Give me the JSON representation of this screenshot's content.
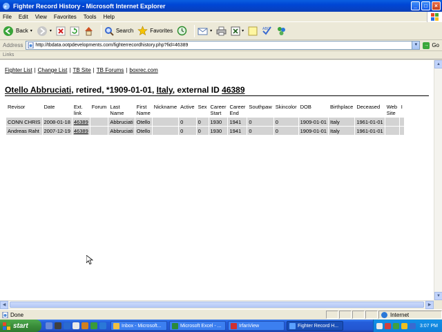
{
  "window": {
    "title": "Fighter Record History - Microsoft Internet Explorer",
    "controls": [
      "_",
      "□",
      "×"
    ]
  },
  "menu": [
    "File",
    "Edit",
    "View",
    "Favorites",
    "Tools",
    "Help"
  ],
  "toolbar": {
    "back": "Back",
    "search": "Search",
    "favorites": "Favorites"
  },
  "address": {
    "label": "Address",
    "url": "http://tbdata.ootpdevelopments.com/fighterrecordhistory.php?fid=46389",
    "go": "Go"
  },
  "links_label": "Links",
  "page": {
    "nav": [
      "Fighter List",
      "Change List",
      "TB Site",
      "TB Forums",
      "boxrec.com"
    ],
    "heading": {
      "name": "Otello Abbruciati",
      "mid": ", retired, *1909-01-01, ",
      "country": "Italy",
      "ext_prefix": ", external ID ",
      "ext_id": "46389"
    },
    "table": {
      "headers": [
        "Revisor",
        "Date",
        "Ext. link",
        "Forum",
        "Last Name",
        "First Name",
        "Nickname",
        "Active",
        "Sex",
        "Career Start",
        "Career End",
        "Southpaw",
        "Skincolor",
        "DOB",
        "Birthplace",
        "Deceased",
        "Web Site",
        "I"
      ],
      "rows": [
        [
          "CONN CHRIS",
          "2008-01-18",
          "46389",
          "",
          "Abbruciati",
          "Otello",
          "",
          "0",
          "0",
          "1930",
          "1941",
          "0",
          "0",
          "1909-01-01",
          "Italy",
          "1961-01-01",
          "",
          ""
        ],
        [
          "Andreas Raht",
          "2007-12-19",
          "46389",
          "",
          "Abbruciati",
          "Otello",
          "",
          "0",
          "0",
          "1930",
          "1941",
          "0",
          "0",
          "1909-01-01",
          "Italy",
          "1961-01-01",
          "",
          ""
        ]
      ]
    }
  },
  "status": {
    "text": "Done",
    "zone": "Internet"
  },
  "taskbar": {
    "start": "start",
    "tasks": [
      "Inbox - Microsoft...",
      "Microsoft Excel - ...",
      "IrfanView",
      "Fighter Record H..."
    ],
    "clock": "3:07 PM"
  },
  "colors": {
    "title_bar": "#0046d5",
    "cell_bg": "#d3d3d3",
    "taskbar": "#245edb",
    "start_button": "#3a8e3a"
  }
}
